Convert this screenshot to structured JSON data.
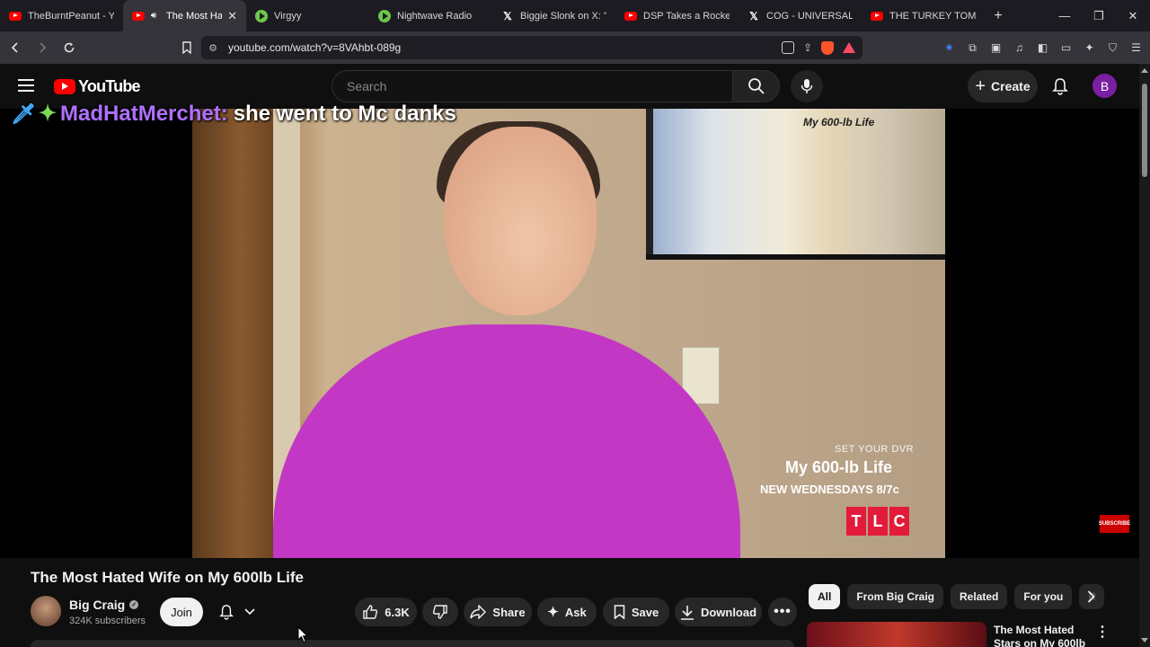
{
  "browser": {
    "tabs": [
      {
        "title": "TheBurntPeanut - You",
        "icon": "youtube-icon",
        "active": false
      },
      {
        "title": "The Most Hate",
        "icon": "youtube-icon",
        "active": true
      },
      {
        "title": "Virgyy",
        "icon": "play-icon",
        "active": false
      },
      {
        "title": "Nightwave Radio",
        "icon": "play-icon",
        "active": false
      },
      {
        "title": "Biggie Slonk on X: \"@",
        "icon": "x-icon",
        "active": false
      },
      {
        "title": "DSP Takes a Rocket to",
        "icon": "youtube-icon",
        "active": false
      },
      {
        "title": "COG - UNIVERSALLY",
        "icon": "x-icon",
        "active": false
      },
      {
        "title": "THE TURKEY TOM SIT",
        "icon": "youtube-icon",
        "active": false
      }
    ],
    "url": "youtube.com/watch?v=8VAhbt-089g",
    "colors": {
      "tabbar": "#1c1b22",
      "toolbar": "#35343a"
    }
  },
  "youtube": {
    "logo_text": "YouTube",
    "search_placeholder": "Search",
    "create_label": "Create",
    "avatar_letter": "B"
  },
  "player": {
    "chat_user": "MadHatMerchet:",
    "chat_message": "she went to Mc danks",
    "poster_title": "My 600-lb Life",
    "promo_small": "SET YOUR DVR",
    "promo_show": "My 600-lb Life",
    "promo_day": "NEW WEDNESDAYS 8/7c",
    "network": [
      "T",
      "L",
      "C"
    ],
    "subscribe_badge": "SUBSCRIBE"
  },
  "video": {
    "title": "The Most Hated Wife on My 600lb Life",
    "channel": "Big Craig",
    "subscribers": "324K subscribers",
    "join_label": "Join",
    "likes": "6.3K",
    "share_label": "Share",
    "ask_label": "Ask",
    "save_label": "Save",
    "download_label": "Download"
  },
  "sidebar": {
    "chips": [
      "All",
      "From Big Craig",
      "Related",
      "For you",
      "R"
    ],
    "rec_title": "The Most Hated Stars on My 600lb"
  }
}
